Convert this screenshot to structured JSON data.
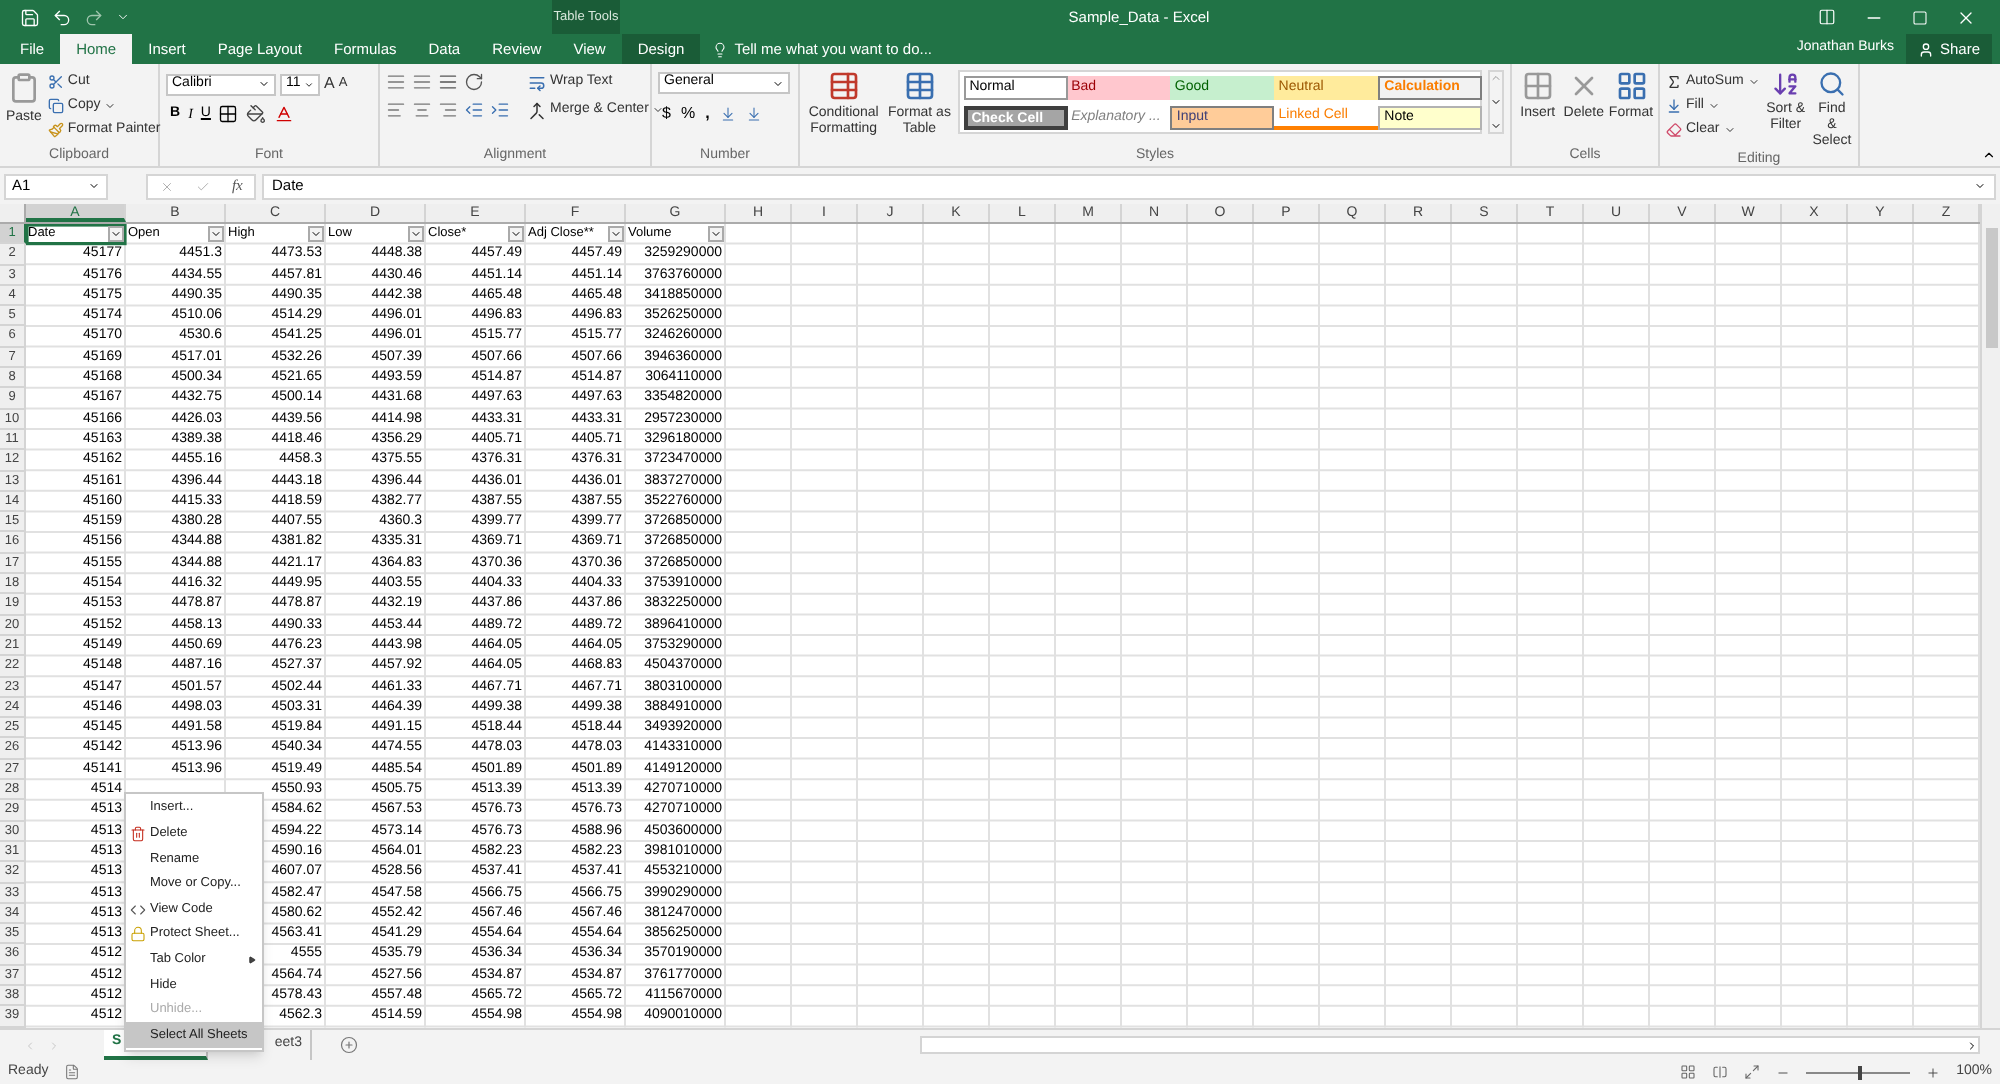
{
  "title_bar": {
    "context_label": "Table Tools",
    "title": "Sample_Data - Excel"
  },
  "tabs": [
    {
      "label": "File",
      "selected": false,
      "kind": "plain"
    },
    {
      "label": "Home",
      "selected": true,
      "kind": "plain"
    },
    {
      "label": "Insert",
      "selected": false,
      "kind": "plain"
    },
    {
      "label": "Page Layout",
      "selected": false,
      "kind": "plain"
    },
    {
      "label": "Formulas",
      "selected": false,
      "kind": "plain"
    },
    {
      "label": "Data",
      "selected": false,
      "kind": "plain"
    },
    {
      "label": "Review",
      "selected": false,
      "kind": "plain"
    },
    {
      "label": "View",
      "selected": false,
      "kind": "plain"
    },
    {
      "label": "Design",
      "selected": false,
      "kind": "contextual"
    }
  ],
  "tell_me": {
    "placeholder": "Tell me what you want to do..."
  },
  "user": {
    "name": "Jonathan Burks",
    "share": "Share"
  },
  "ribbon": {
    "clipboard": {
      "label": "Clipboard",
      "paste": "Paste",
      "cut": "Cut",
      "copy": "Copy",
      "format_painter": "Format Painter"
    },
    "font": {
      "label": "Font",
      "font_name": "Calibri",
      "font_size": "11",
      "grow": "A",
      "shrink": "A",
      "bold": "B",
      "italic": "I",
      "underline": "U"
    },
    "alignment": {
      "label": "Alignment",
      "wrap_text": "Wrap Text",
      "merge_center": "Merge & Center"
    },
    "number": {
      "label": "Number",
      "format": "General",
      "currency": "$",
      "percent": "%",
      "comma": ","
    },
    "styles": {
      "label": "Styles",
      "conditional_formatting": "Conditional Formatting",
      "format_as_table": "Format as Table",
      "gallery": [
        {
          "label": "Normal",
          "kind": "normal"
        },
        {
          "label": "Bad",
          "kind": "bad"
        },
        {
          "label": "Good",
          "kind": "good"
        },
        {
          "label": "Neutral",
          "kind": "neutral"
        },
        {
          "label": "Calculation",
          "kind": "calculation"
        },
        {
          "label": "Check Cell",
          "kind": "check"
        },
        {
          "label": "Explanatory ...",
          "kind": "explanatory"
        },
        {
          "label": "Input",
          "kind": "input"
        },
        {
          "label": "Linked Cell",
          "kind": "linked"
        },
        {
          "label": "Note",
          "kind": "note"
        }
      ]
    },
    "cells": {
      "label": "Cells",
      "buttons": [
        "Insert",
        "Delete",
        "Format"
      ]
    },
    "editing": {
      "label": "Editing",
      "autosum": "AutoSum",
      "fill": "Fill",
      "clear": "Clear",
      "sort_filter": "Sort & Filter",
      "find_select": "Find & Select"
    }
  },
  "formula_bar": {
    "name_box": "A1",
    "function_label": "fx",
    "value": "Date"
  },
  "grid": {
    "columns": [
      {
        "label": "A",
        "selected": true
      },
      {
        "label": "B",
        "selected": false
      },
      {
        "label": "C",
        "selected": false
      },
      {
        "label": "D",
        "selected": false
      },
      {
        "label": "E",
        "selected": false
      },
      {
        "label": "F",
        "selected": false
      },
      {
        "label": "G",
        "selected": false
      },
      {
        "label": "H",
        "selected": false
      },
      {
        "label": "I",
        "selected": false
      },
      {
        "label": "J",
        "selected": false
      },
      {
        "label": "K",
        "selected": false
      },
      {
        "label": "L",
        "selected": false
      },
      {
        "label": "M",
        "selected": false
      },
      {
        "label": "N",
        "selected": false
      },
      {
        "label": "O",
        "selected": false
      },
      {
        "label": "P",
        "selected": false
      },
      {
        "label": "Q",
        "selected": false
      },
      {
        "label": "R",
        "selected": false
      },
      {
        "label": "S",
        "selected": false
      },
      {
        "label": "T",
        "selected": false
      },
      {
        "label": "U",
        "selected": false
      },
      {
        "label": "V",
        "selected": false
      },
      {
        "label": "W",
        "selected": false
      },
      {
        "label": "X",
        "selected": false
      },
      {
        "label": "Y",
        "selected": false
      },
      {
        "label": "Z",
        "selected": false
      }
    ],
    "rows": [
      {
        "label": "1",
        "selected": true,
        "kind": "header",
        "cells": {
          "A": "Date",
          "B": "Open",
          "C": "High",
          "D": "Low",
          "E": "Close*",
          "F": "Adj Close**",
          "G": "Volume"
        }
      },
      {
        "label": "2",
        "selected": false,
        "kind": "data",
        "cells": {
          "A": "45177",
          "B": "4451.3",
          "C": "4473.53",
          "D": "4448.38",
          "E": "4457.49",
          "F": "4457.49",
          "G": "3259290000"
        }
      },
      {
        "label": "3",
        "selected": false,
        "kind": "data",
        "cells": {
          "A": "45176",
          "B": "4434.55",
          "C": "4457.81",
          "D": "4430.46",
          "E": "4451.14",
          "F": "4451.14",
          "G": "3763760000"
        }
      },
      {
        "label": "4",
        "selected": false,
        "kind": "data",
        "cells": {
          "A": "45175",
          "B": "4490.35",
          "C": "4490.35",
          "D": "4442.38",
          "E": "4465.48",
          "F": "4465.48",
          "G": "3418850000"
        }
      },
      {
        "label": "5",
        "selected": false,
        "kind": "data",
        "cells": {
          "A": "45174",
          "B": "4510.06",
          "C": "4514.29",
          "D": "4496.01",
          "E": "4496.83",
          "F": "4496.83",
          "G": "3526250000"
        }
      },
      {
        "label": "6",
        "selected": false,
        "kind": "data",
        "cells": {
          "A": "45170",
          "B": "4530.6",
          "C": "4541.25",
          "D": "4496.01",
          "E": "4515.77",
          "F": "4515.77",
          "G": "3246260000"
        }
      },
      {
        "label": "7",
        "selected": false,
        "kind": "data",
        "cells": {
          "A": "45169",
          "B": "4517.01",
          "C": "4532.26",
          "D": "4507.39",
          "E": "4507.66",
          "F": "4507.66",
          "G": "3946360000"
        }
      },
      {
        "label": "8",
        "selected": false,
        "kind": "data",
        "cells": {
          "A": "45168",
          "B": "4500.34",
          "C": "4521.65",
          "D": "4493.59",
          "E": "4514.87",
          "F": "4514.87",
          "G": "3064110000"
        }
      },
      {
        "label": "9",
        "selected": false,
        "kind": "data",
        "cells": {
          "A": "45167",
          "B": "4432.75",
          "C": "4500.14",
          "D": "4431.68",
          "E": "4497.63",
          "F": "4497.63",
          "G": "3354820000"
        }
      },
      {
        "label": "10",
        "selected": false,
        "kind": "data",
        "cells": {
          "A": "45166",
          "B": "4426.03",
          "C": "4439.56",
          "D": "4414.98",
          "E": "4433.31",
          "F": "4433.31",
          "G": "2957230000"
        }
      },
      {
        "label": "11",
        "selected": false,
        "kind": "data",
        "cells": {
          "A": "45163",
          "B": "4389.38",
          "C": "4418.46",
          "D": "4356.29",
          "E": "4405.71",
          "F": "4405.71",
          "G": "3296180000"
        }
      },
      {
        "label": "12",
        "selected": false,
        "kind": "data",
        "cells": {
          "A": "45162",
          "B": "4455.16",
          "C": "4458.3",
          "D": "4375.55",
          "E": "4376.31",
          "F": "4376.31",
          "G": "3723470000"
        }
      },
      {
        "label": "13",
        "selected": false,
        "kind": "data",
        "cells": {
          "A": "45161",
          "B": "4396.44",
          "C": "4443.18",
          "D": "4396.44",
          "E": "4436.01",
          "F": "4436.01",
          "G": "3837270000"
        }
      },
      {
        "label": "14",
        "selected": false,
        "kind": "data",
        "cells": {
          "A": "45160",
          "B": "4415.33",
          "C": "4418.59",
          "D": "4382.77",
          "E": "4387.55",
          "F": "4387.55",
          "G": "3522760000"
        }
      },
      {
        "label": "15",
        "selected": false,
        "kind": "data",
        "cells": {
          "A": "45159",
          "B": "4380.28",
          "C": "4407.55",
          "D": "4360.3",
          "E": "4399.77",
          "F": "4399.77",
          "G": "3726850000"
        }
      },
      {
        "label": "16",
        "selected": false,
        "kind": "data",
        "cells": {
          "A": "45156",
          "B": "4344.88",
          "C": "4381.82",
          "D": "4335.31",
          "E": "4369.71",
          "F": "4369.71",
          "G": "3726850000"
        }
      },
      {
        "label": "17",
        "selected": false,
        "kind": "data",
        "cells": {
          "A": "45155",
          "B": "4344.88",
          "C": "4421.17",
          "D": "4364.83",
          "E": "4370.36",
          "F": "4370.36",
          "G": "3726850000"
        }
      },
      {
        "label": "18",
        "selected": false,
        "kind": "data",
        "cells": {
          "A": "45154",
          "B": "4416.32",
          "C": "4449.95",
          "D": "4403.55",
          "E": "4404.33",
          "F": "4404.33",
          "G": "3753910000"
        }
      },
      {
        "label": "19",
        "selected": false,
        "kind": "data",
        "cells": {
          "A": "45153",
          "B": "4478.87",
          "C": "4478.87",
          "D": "4432.19",
          "E": "4437.86",
          "F": "4437.86",
          "G": "3832250000"
        }
      },
      {
        "label": "20",
        "selected": false,
        "kind": "data",
        "cells": {
          "A": "45152",
          "B": "4458.13",
          "C": "4490.33",
          "D": "4453.44",
          "E": "4489.72",
          "F": "4489.72",
          "G": "3896410000"
        }
      },
      {
        "label": "21",
        "selected": false,
        "kind": "data",
        "cells": {
          "A": "45149",
          "B": "4450.69",
          "C": "4476.23",
          "D": "4443.98",
          "E": "4464.05",
          "F": "4464.05",
          "G": "3753290000"
        }
      },
      {
        "label": "22",
        "selected": false,
        "kind": "data",
        "cells": {
          "A": "45148",
          "B": "4487.16",
          "C": "4527.37",
          "D": "4457.92",
          "E": "4464.05",
          "F": "4468.83",
          "G": "4504370000"
        }
      },
      {
        "label": "23",
        "selected": false,
        "kind": "data",
        "cells": {
          "A": "45147",
          "B": "4501.57",
          "C": "4502.44",
          "D": "4461.33",
          "E": "4467.71",
          "F": "4467.71",
          "G": "3803100000"
        }
      },
      {
        "label": "24",
        "selected": false,
        "kind": "data",
        "cells": {
          "A": "45146",
          "B": "4498.03",
          "C": "4503.31",
          "D": "4464.39",
          "E": "4499.38",
          "F": "4499.38",
          "G": "3884910000"
        }
      },
      {
        "label": "25",
        "selected": false,
        "kind": "data",
        "cells": {
          "A": "45145",
          "B": "4491.58",
          "C": "4519.84",
          "D": "4491.15",
          "E": "4518.44",
          "F": "4518.44",
          "G": "3493920000"
        }
      },
      {
        "label": "26",
        "selected": false,
        "kind": "data",
        "cells": {
          "A": "45142",
          "B": "4513.96",
          "C": "4540.34",
          "D": "4474.55",
          "E": "4478.03",
          "F": "4478.03",
          "G": "4143310000"
        }
      },
      {
        "label": "27",
        "selected": false,
        "kind": "data",
        "cells": {
          "A": "45141",
          "B": "4513.96",
          "C": "4519.49",
          "D": "4485.54",
          "E": "4501.89",
          "F": "4501.89",
          "G": "4149120000"
        }
      },
      {
        "label": "28",
        "selected": false,
        "kind": "data",
        "cells": {
          "A": "4514",
          "C": "4550.93",
          "D": "4505.75",
          "E": "4513.39",
          "F": "4513.39",
          "G": "4270710000"
        }
      },
      {
        "label": "29",
        "selected": false,
        "kind": "data",
        "cells": {
          "A": "4513",
          "C": "4584.62",
          "D": "4567.53",
          "E": "4576.73",
          "F": "4576.73",
          "G": "4270710000"
        }
      },
      {
        "label": "30",
        "selected": false,
        "kind": "data",
        "cells": {
          "A": "4513",
          "C": "4594.22",
          "D": "4573.14",
          "E": "4576.73",
          "F": "4588.96",
          "G": "4503600000"
        }
      },
      {
        "label": "31",
        "selected": false,
        "kind": "data",
        "cells": {
          "A": "4513",
          "C": "4590.16",
          "D": "4564.01",
          "E": "4582.23",
          "F": "4582.23",
          "G": "3981010000"
        }
      },
      {
        "label": "32",
        "selected": false,
        "kind": "data",
        "cells": {
          "A": "4513",
          "C": "4607.07",
          "D": "4528.56",
          "E": "4537.41",
          "F": "4537.41",
          "G": "4553210000"
        }
      },
      {
        "label": "33",
        "selected": false,
        "kind": "data",
        "cells": {
          "A": "4513",
          "C": "4582.47",
          "D": "4547.58",
          "E": "4566.75",
          "F": "4566.75",
          "G": "3990290000"
        }
      },
      {
        "label": "34",
        "selected": false,
        "kind": "data",
        "cells": {
          "A": "4513",
          "C": "4580.62",
          "D": "4552.42",
          "E": "4567.46",
          "F": "4567.46",
          "G": "3812470000"
        }
      },
      {
        "label": "35",
        "selected": false,
        "kind": "data",
        "cells": {
          "A": "4513",
          "C": "4563.41",
          "D": "4541.29",
          "E": "4554.64",
          "F": "4554.64",
          "G": "3856250000"
        }
      },
      {
        "label": "36",
        "selected": false,
        "kind": "data",
        "cells": {
          "A": "4512",
          "C": "4555",
          "D": "4535.79",
          "E": "4536.34",
          "F": "4536.34",
          "G": "3570190000"
        }
      },
      {
        "label": "37",
        "selected": false,
        "kind": "data",
        "cells": {
          "A": "4512",
          "C": "4564.74",
          "D": "4527.56",
          "E": "4534.87",
          "F": "4534.87",
          "G": "3761770000"
        }
      },
      {
        "label": "38",
        "selected": false,
        "kind": "data",
        "cells": {
          "A": "4512",
          "C": "4578.43",
          "D": "4557.48",
          "E": "4565.72",
          "F": "4565.72",
          "G": "4115670000"
        }
      },
      {
        "label": "39",
        "selected": false,
        "kind": "data",
        "cells": {
          "A": "4512",
          "C": "4562.3",
          "D": "4514.59",
          "E": "4554.98",
          "F": "4554.98",
          "G": "4090010000"
        }
      }
    ]
  },
  "context_menu": [
    {
      "label": "Insert...",
      "disabled": false,
      "selected": false,
      "submenu": false
    },
    {
      "label": "Delete",
      "disabled": false,
      "selected": false,
      "submenu": false
    },
    {
      "label": "Rename",
      "disabled": false,
      "selected": false,
      "submenu": false
    },
    {
      "label": "Move or Copy...",
      "disabled": false,
      "selected": false,
      "submenu": false
    },
    {
      "label": "View Code",
      "disabled": false,
      "selected": false,
      "submenu": false
    },
    {
      "label": "Protect Sheet...",
      "disabled": false,
      "selected": false,
      "submenu": false
    },
    {
      "label": "Tab Color",
      "disabled": false,
      "selected": false,
      "submenu": true
    },
    {
      "label": "Hide",
      "disabled": false,
      "selected": false,
      "submenu": false
    },
    {
      "label": "Unhide...",
      "disabled": true,
      "selected": false,
      "submenu": false
    },
    {
      "label": "Select All Sheets",
      "disabled": false,
      "selected": true,
      "submenu": false
    }
  ],
  "sheet_tabs": [
    {
      "label": "S",
      "selected": true
    },
    {
      "label": "eet3",
      "selected": false
    }
  ],
  "status_bar": {
    "status": "Ready",
    "zoom": {
      "level": 0.5,
      "reading": "100%"
    }
  }
}
